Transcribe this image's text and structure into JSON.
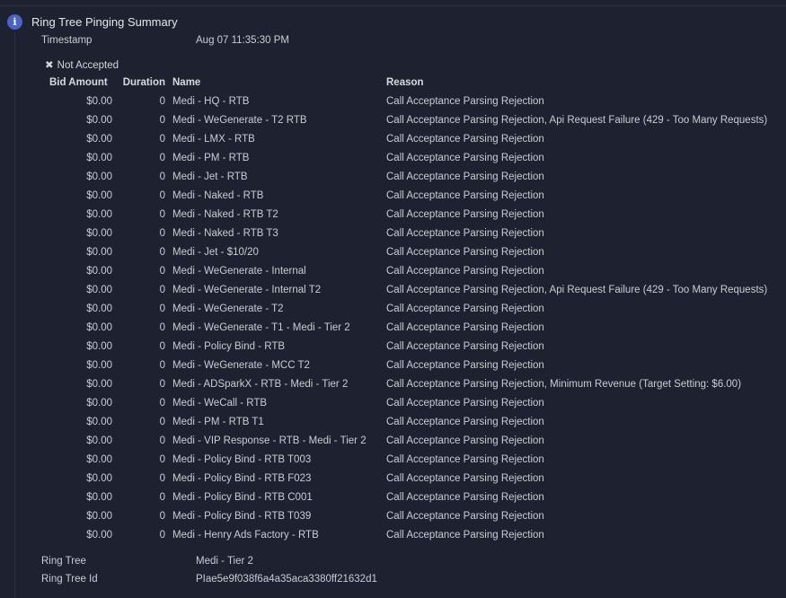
{
  "panel": {
    "title": "Ring Tree Pinging Summary",
    "timestamp_label": "Timestamp",
    "timestamp_value": "Aug 07 11:35:30 PM",
    "status_icon": "x-icon",
    "status_label": "Not Accepted"
  },
  "table": {
    "headers": {
      "bid": "Bid Amount",
      "duration": "Duration",
      "name": "Name",
      "reason": "Reason"
    },
    "rows": [
      {
        "bid": "$0.00",
        "duration": "0",
        "name": "Medi - HQ - RTB",
        "reason": "Call Acceptance Parsing Rejection"
      },
      {
        "bid": "$0.00",
        "duration": "0",
        "name": "Medi - WeGenerate - T2 RTB",
        "reason": "Call Acceptance Parsing Rejection, Api Request Failure (429 - Too Many Requests)"
      },
      {
        "bid": "$0.00",
        "duration": "0",
        "name": "Medi - LMX - RTB",
        "reason": "Call Acceptance Parsing Rejection"
      },
      {
        "bid": "$0.00",
        "duration": "0",
        "name": "Medi - PM - RTB",
        "reason": "Call Acceptance Parsing Rejection"
      },
      {
        "bid": "$0.00",
        "duration": "0",
        "name": "Medi - Jet - RTB",
        "reason": "Call Acceptance Parsing Rejection"
      },
      {
        "bid": "$0.00",
        "duration": "0",
        "name": "Medi - Naked - RTB",
        "reason": "Call Acceptance Parsing Rejection"
      },
      {
        "bid": "$0.00",
        "duration": "0",
        "name": "Medi - Naked - RTB T2",
        "reason": "Call Acceptance Parsing Rejection"
      },
      {
        "bid": "$0.00",
        "duration": "0",
        "name": "Medi - Naked - RTB T3",
        "reason": "Call Acceptance Parsing Rejection"
      },
      {
        "bid": "$0.00",
        "duration": "0",
        "name": "Medi - Jet - $10/20",
        "reason": "Call Acceptance Parsing Rejection"
      },
      {
        "bid": "$0.00",
        "duration": "0",
        "name": "Medi - WeGenerate - Internal",
        "reason": "Call Acceptance Parsing Rejection"
      },
      {
        "bid": "$0.00",
        "duration": "0",
        "name": "Medi - WeGenerate - Internal T2",
        "reason": "Call Acceptance Parsing Rejection, Api Request Failure (429 - Too Many Requests)"
      },
      {
        "bid": "$0.00",
        "duration": "0",
        "name": "Medi - WeGenerate - T2",
        "reason": "Call Acceptance Parsing Rejection"
      },
      {
        "bid": "$0.00",
        "duration": "0",
        "name": "Medi - WeGenerate - T1 - Medi - Tier 2",
        "reason": "Call Acceptance Parsing Rejection"
      },
      {
        "bid": "$0.00",
        "duration": "0",
        "name": "Medi - Policy Bind - RTB",
        "reason": "Call Acceptance Parsing Rejection"
      },
      {
        "bid": "$0.00",
        "duration": "0",
        "name": "Medi - WeGenerate - MCC T2",
        "reason": "Call Acceptance Parsing Rejection"
      },
      {
        "bid": "$0.00",
        "duration": "0",
        "name": "Medi - ADSparkX - RTB - Medi - Tier 2",
        "reason": "Call Acceptance Parsing Rejection, Minimum Revenue (Target Setting: $6.00)"
      },
      {
        "bid": "$0.00",
        "duration": "0",
        "name": "Medi - WeCall - RTB",
        "reason": "Call Acceptance Parsing Rejection"
      },
      {
        "bid": "$0.00",
        "duration": "0",
        "name": "Medi - PM - RTB T1",
        "reason": "Call Acceptance Parsing Rejection"
      },
      {
        "bid": "$0.00",
        "duration": "0",
        "name": "Medi - VIP Response - RTB - Medi - Tier 2",
        "reason": "Call Acceptance Parsing Rejection"
      },
      {
        "bid": "$0.00",
        "duration": "0",
        "name": "Medi - Policy Bind - RTB T003",
        "reason": "Call Acceptance Parsing Rejection"
      },
      {
        "bid": "$0.00",
        "duration": "0",
        "name": "Medi - Policy Bind - RTB F023",
        "reason": "Call Acceptance Parsing Rejection"
      },
      {
        "bid": "$0.00",
        "duration": "0",
        "name": "Medi - Policy Bind - RTB C001",
        "reason": "Call Acceptance Parsing Rejection"
      },
      {
        "bid": "$0.00",
        "duration": "0",
        "name": "Medi - Policy Bind - RTB T039",
        "reason": "Call Acceptance Parsing Rejection"
      },
      {
        "bid": "$0.00",
        "duration": "0",
        "name": "Medi - Henry Ads Factory - RTB",
        "reason": "Call Acceptance Parsing Rejection"
      }
    ]
  },
  "footer": {
    "ring_tree_label": "Ring Tree",
    "ring_tree_value": "Medi - Tier 2",
    "ring_tree_id_label": "Ring Tree Id",
    "ring_tree_id_value": "PIae5e9f038f6a4a35aca3380ff21632d1"
  },
  "colors": {
    "background": "#1e2230",
    "info_icon": "#4a63c4",
    "text": "#c9ccd4"
  }
}
